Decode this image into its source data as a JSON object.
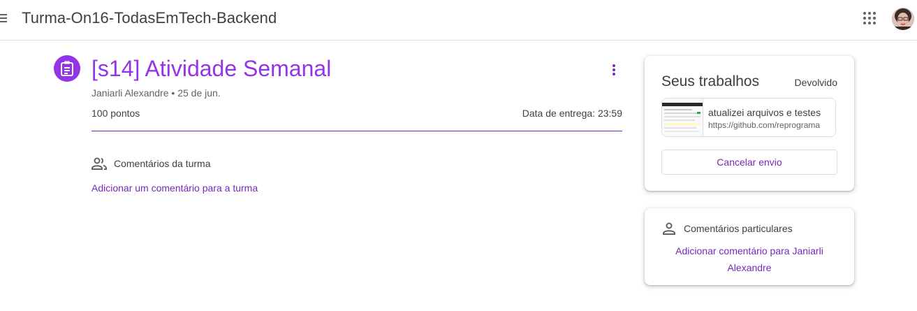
{
  "header": {
    "menu_icon": "menu-icon",
    "title": "Turma-On16-TodasEmTech-Backend",
    "apps_icon": "apps-grid-icon",
    "avatar_icon": "user-avatar"
  },
  "assignment": {
    "icon": "assignment-icon",
    "title": "[s14] Atividade Semanal",
    "author_line": "Janiarli Alexandre • 25 de jun.",
    "points": "100 pontos",
    "due": "Data de entrega: 23:59",
    "accent_color": "#9334e6",
    "link_color": "#7627bb"
  },
  "class_comments": {
    "icon": "people-icon",
    "label": "Comentários da turma",
    "add_link": "Adicionar um comentário para a turma"
  },
  "your_work": {
    "title": "Seus trabalhos",
    "status": "Devolvido",
    "attachment": {
      "title": "atualizei arquivos e testes",
      "url": "https://github.com/reprograma"
    },
    "cancel_button": "Cancelar envio"
  },
  "private_comments": {
    "icon": "person-icon",
    "label": "Comentários particulares",
    "add_link": "Adicionar comentário para Janiarli Alexandre"
  }
}
